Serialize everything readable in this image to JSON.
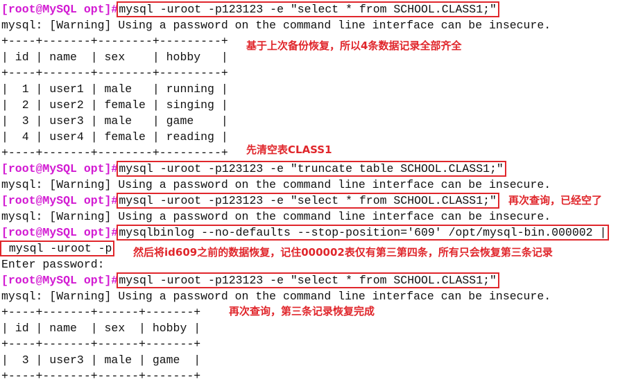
{
  "prompt": "[root@MySQL opt]#",
  "lines": [
    {
      "prompt": true,
      "command": "mysql -uroot -p123123 -e \"select * from SCHOOL.CLASS1;\""
    },
    {
      "text": "mysql: [Warning] Using a password on the command line interface can be insecure."
    },
    {
      "text": "+----+-------+--------+---------+"
    },
    {
      "text": "| id | name  | sex    | hobby   |"
    },
    {
      "text": "+----+-------+--------+---------+"
    },
    {
      "text": "|  1 | user1 | male   | running |"
    },
    {
      "text": "|  2 | user2 | female | singing |"
    },
    {
      "text": "|  3 | user3 | male   | game    |"
    },
    {
      "text": "|  4 | user4 | female | reading |"
    },
    {
      "text": "+----+-------+--------+---------+"
    },
    {
      "prompt": true,
      "command": "mysql -uroot -p123123 -e \"truncate table SCHOOL.CLASS1;\""
    },
    {
      "text": "mysql: [Warning] Using a password on the command line interface can be insecure."
    },
    {
      "prompt": true,
      "command": "mysql -uroot -p123123 -e \"select * from SCHOOL.CLASS1;\""
    },
    {
      "text": "mysql: [Warning] Using a password on the command line interface can be insecure."
    },
    {
      "prompt": true,
      "command": "mysqlbinlog --no-defaults --stop-position='609' /opt/mysql-bin.000002 |"
    },
    {
      "command": " mysql -uroot -p"
    },
    {
      "text": "Enter password:"
    },
    {
      "prompt": true,
      "command": "mysql -uroot -p123123 -e \"select * from SCHOOL.CLASS1;\""
    },
    {
      "text": "mysql: [Warning] Using a password on the command line interface can be insecure."
    },
    {
      "text": "+----+-------+------+-------+"
    },
    {
      "text": "| id | name  | sex  | hobby |"
    },
    {
      "text": "+----+-------+------+-------+"
    },
    {
      "text": "|  3 | user3 | male | game  |"
    },
    {
      "text": "+----+-------+------+-------+"
    }
  ],
  "annotations": [
    "基于上次备份恢复，所以4条数据记录全部齐全",
    "先清空表CLASS1",
    "再次查询，已经空了",
    "然后将id609之前的数据恢复，记住000002表仅有第三第四条，所有只会恢复第三条记录",
    "再次查询，第三条记录恢复完成"
  ],
  "colors": {
    "prompt": "#d21ad2",
    "annotation": "#e0262b",
    "highlight_box": "#e0262b"
  }
}
